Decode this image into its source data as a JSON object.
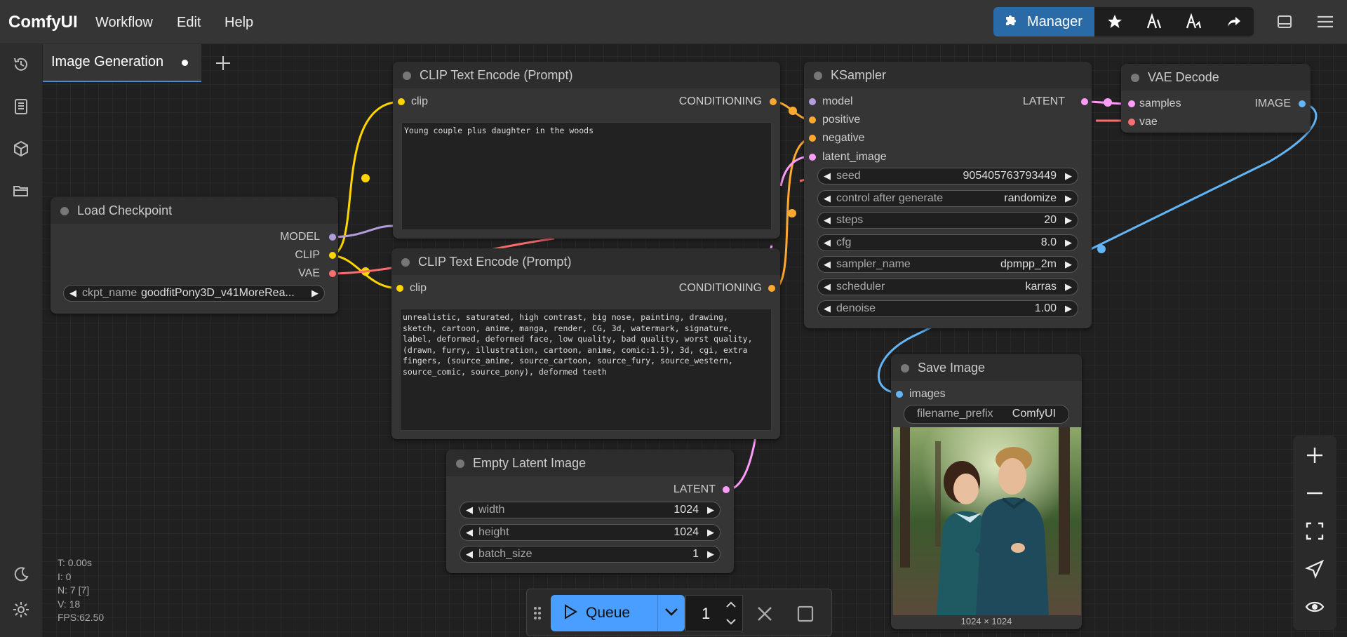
{
  "app": {
    "title": "ComfyUI"
  },
  "menu": {
    "workflow": "Workflow",
    "edit": "Edit",
    "help": "Help"
  },
  "toolbar": {
    "manager_label": "Manager"
  },
  "tabs": [
    {
      "label": "Image Generation",
      "modified": true
    }
  ],
  "nodes": {
    "load_checkpoint": {
      "title": "Load Checkpoint",
      "outputs": [
        "MODEL",
        "CLIP",
        "VAE"
      ],
      "widgets": {
        "ckpt_name": {
          "name": "ckpt_name",
          "value": "goodfitPony3D_v41MoreRea..."
        }
      }
    },
    "clip_positive": {
      "title": "CLIP Text Encode (Prompt)",
      "input": "clip",
      "output": "CONDITIONING",
      "text": "Young couple plus daughter in the woods"
    },
    "clip_negative": {
      "title": "CLIP Text Encode (Prompt)",
      "input": "clip",
      "output": "CONDITIONING",
      "text": "unrealistic, saturated, high contrast, big nose, painting, drawing,\nsketch, cartoon, anime, manga, render, CG, 3d, watermark, signature,\nlabel, deformed, deformed face, low quality, bad quality, worst quality,\n(drawn, furry, illustration, cartoon, anime, comic:1.5), 3d, cgi, extra\nfingers, (source_anime, source_cartoon, source_fury, source_western,\nsource_comic, source_pony), deformed teeth"
    },
    "ksampler": {
      "title": "KSampler",
      "inputs": [
        "model",
        "positive",
        "negative",
        "latent_image"
      ],
      "output": "LATENT",
      "widgets": [
        {
          "name": "seed",
          "value": "905405763793449"
        },
        {
          "name": "control after generate",
          "value": "randomize"
        },
        {
          "name": "steps",
          "value": "20"
        },
        {
          "name": "cfg",
          "value": "8.0"
        },
        {
          "name": "sampler_name",
          "value": "dpmpp_2m"
        },
        {
          "name": "scheduler",
          "value": "karras"
        },
        {
          "name": "denoise",
          "value": "1.00"
        }
      ]
    },
    "vae_decode": {
      "title": "VAE Decode",
      "inputs": [
        "samples",
        "vae"
      ],
      "output": "IMAGE"
    },
    "empty_latent": {
      "title": "Empty Latent Image",
      "output": "LATENT",
      "widgets": [
        {
          "name": "width",
          "value": "1024"
        },
        {
          "name": "height",
          "value": "1024"
        },
        {
          "name": "batch_size",
          "value": "1"
        }
      ]
    },
    "save_image": {
      "title": "Save Image",
      "input": "images",
      "widgets": {
        "filename_prefix": {
          "name": "filename_prefix",
          "value": "ComfyUI"
        }
      },
      "image_caption": "1024 × 1024"
    }
  },
  "stats": {
    "t": "T: 0.00s",
    "i": "I: 0",
    "n": "N: 7 [7]",
    "v": "V: 18",
    "fps": "FPS:62.50"
  },
  "queue": {
    "label": "Queue",
    "count": "1"
  },
  "colors": {
    "clip": "#ffd500",
    "model": "#b39ddb",
    "vae": "#ff6e6e",
    "conditioning": "#ffa931",
    "latent": "#ff9cf9",
    "image": "#64b5f6",
    "accent": "#2a6aa6",
    "queue": "#4a9eff"
  }
}
